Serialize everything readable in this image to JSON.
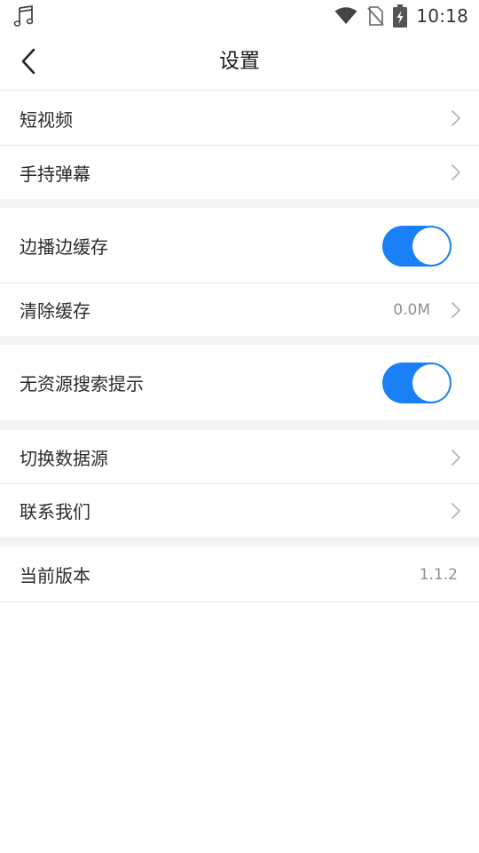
{
  "status_bar": {
    "time": "10:18",
    "icons": [
      "music-note-icon",
      "wifi-icon",
      "no-sim-icon",
      "battery-charging-icon"
    ]
  },
  "header": {
    "title": "设置",
    "back_icon": "chevron-left-icon"
  },
  "sections": [
    {
      "items": [
        {
          "label": "短视频",
          "type": "link"
        },
        {
          "label": "手持弹幕",
          "type": "link"
        }
      ]
    },
    {
      "items": [
        {
          "label": "边播边缓存",
          "type": "toggle",
          "on": true
        },
        {
          "label": "清除缓存",
          "type": "link",
          "value": "0.0M"
        }
      ]
    },
    {
      "items": [
        {
          "label": "无资源搜索提示",
          "type": "toggle",
          "on": true
        }
      ]
    },
    {
      "items": [
        {
          "label": "切换数据源",
          "type": "link"
        },
        {
          "label": "联系我们",
          "type": "link"
        }
      ]
    },
    {
      "items": [
        {
          "label": "当前版本",
          "type": "info",
          "value": "1.1.2"
        }
      ]
    }
  ],
  "colors": {
    "accent": "#1a80f5",
    "section_gap": "#f4f4f4",
    "divider": "#e8e8e8",
    "value_text": "#8f8f8f"
  }
}
